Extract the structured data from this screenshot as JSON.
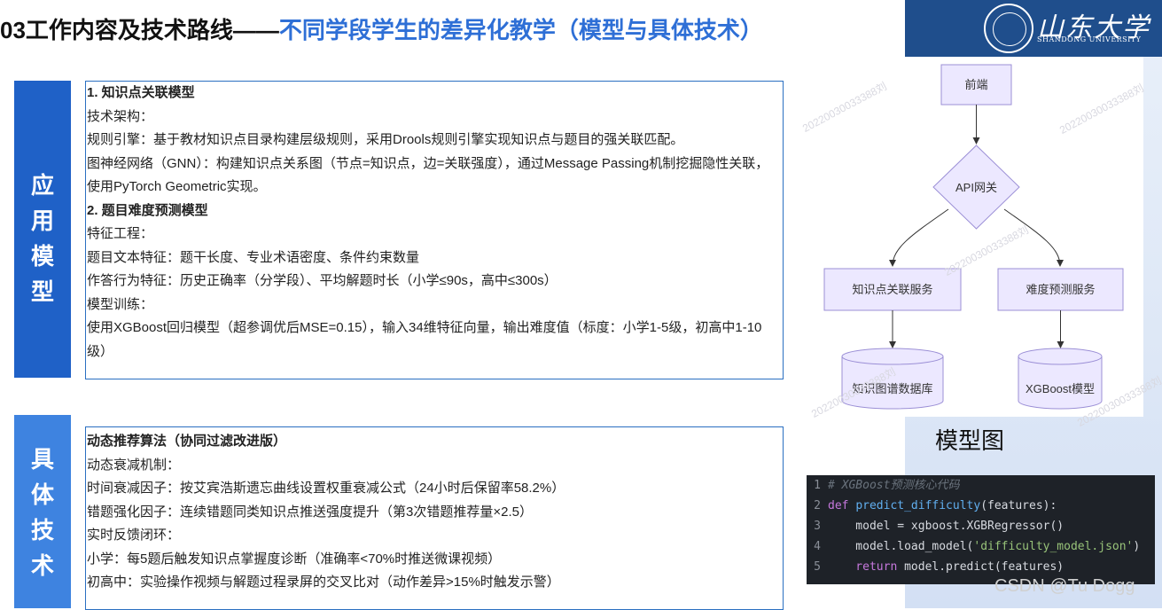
{
  "slide": {
    "title_prefix": "03工作内容及技术路线——",
    "title_highlight": "不同学段学生的差异化教学（模型与具体技术）"
  },
  "logo": {
    "cn": "山东大学",
    "en": "SHANDONG UNIVERSITY"
  },
  "sections": {
    "app_model": {
      "label_chars": [
        "应",
        "用",
        "模",
        "型"
      ]
    },
    "tech": {
      "label_chars": [
        "具",
        "体",
        "技",
        "术"
      ]
    }
  },
  "app_model_box": {
    "l1": "1. 知识点关联模型",
    "l2": "技术架构：",
    "l3": "规则引擎：基于教材知识点目录构建层级规则，采用Drools规则引擎实现知识点与题目的强关联匹配。",
    "l4": "图神经网络（GNN）：构建知识点关系图（节点=知识点，边=关联强度），通过Message  Passing机制挖掘隐性关联，使用PyTorch Geometric实现。",
    "l5": "2. 题目难度预测模型",
    "l6": "特征工程：",
    "l7": "题目文本特征：题干长度、专业术语密度、条件约束数量",
    "l8": "作答行为特征：历史正确率（分学段）、平均解题时长（小学≤90s，高中≤300s）",
    "l9": "模型训练：",
    "l10": "使用XGBoost回归模型（超参调优后MSE=0.15），输入34维特征向量，输出难度值（标度：小学1-5级，初高中1-10级）"
  },
  "tech_box": {
    "l1": "动态推荐算法（协同过滤改进版）",
    "l2": "动态衰减机制：",
    "l3": "时间衰减因子：按艾宾浩斯遗忘曲线设置权重衰减公式（24小时后保留率58.2%）",
    "l4": "错题强化因子：连续错题同类知识点推送强度提升（第3次错题推荐量×2.5）",
    "l5": "实时反馈闭环：",
    "l6": "小学：每5题后触发知识点掌握度诊断（准确率<70%时推送微课视频）",
    "l7": "初高中：实验操作视频与解题过程录屏的交叉比对（动作差异>15%时触发示警）"
  },
  "diagram": {
    "frontend": "前端",
    "gateway": "API网关",
    "svc_knowledge": "知识点关联服务",
    "svc_difficulty": "难度预测服务",
    "db_kg": "知识图谱数据库",
    "db_xgb": "XGBoost模型",
    "watermark": "20220030033388刘"
  },
  "model_caption": "模型图",
  "code": {
    "line_numbers": [
      "1",
      "2",
      "3",
      "4",
      "5"
    ],
    "l1_comment": "# XGBoost预测核心代码",
    "l2_kw": "def ",
    "l2_fn": "predict_difficulty",
    "l2_rest": "(features):",
    "l3": "    model = xgboost.XGBRegressor()",
    "l4_pre": "    model.load_model(",
    "l4_str": "'difficulty_model.json'",
    "l4_post": ")",
    "l5_kw": "    return ",
    "l5_rest": "model.predict(features)"
  },
  "watermark_csdn": "CSDN @Tu Dogg"
}
